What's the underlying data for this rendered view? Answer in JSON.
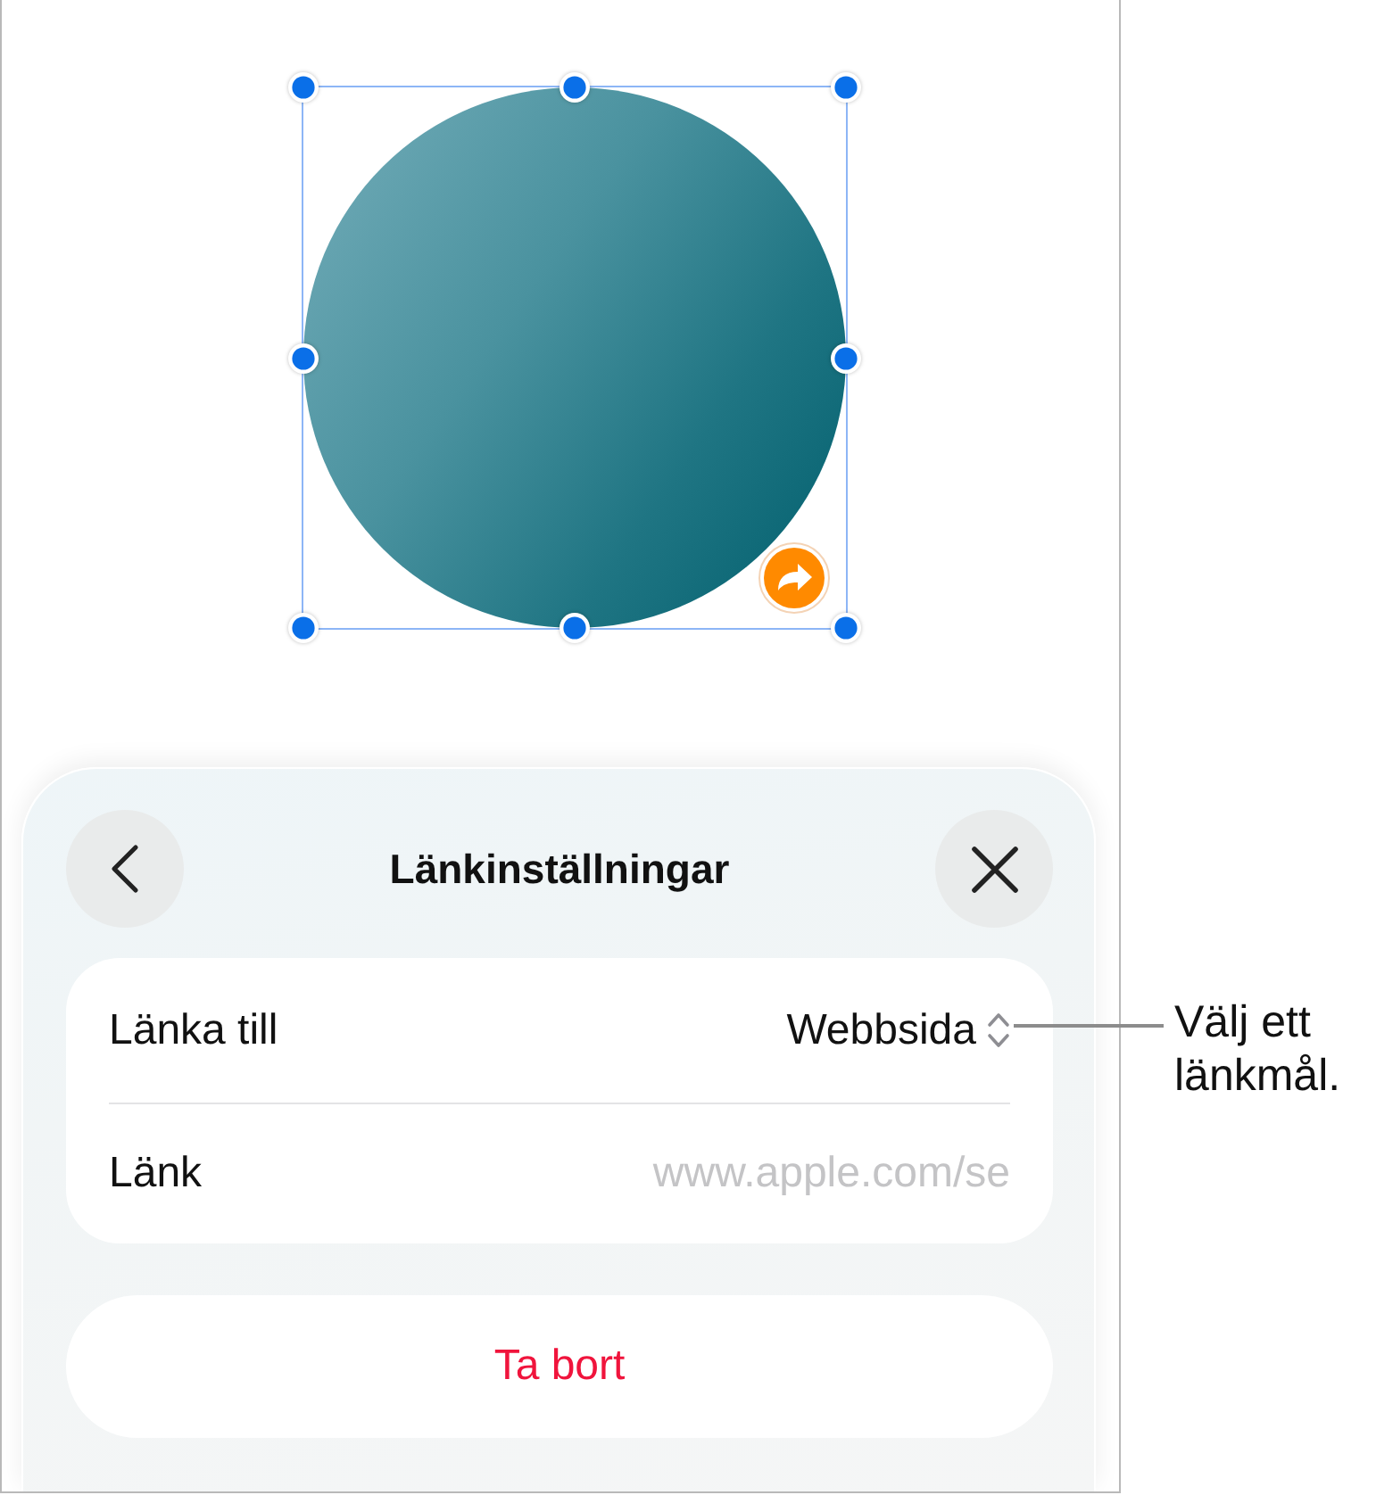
{
  "canvas": {
    "shape": {
      "selected": true,
      "linked": true
    }
  },
  "panel": {
    "title": "Länkinställningar",
    "rows": [
      {
        "kind": "picker",
        "label": "Länka till",
        "value": "Webbsida"
      },
      {
        "kind": "field",
        "label": "Länk",
        "placeholder": "www.apple.com/se"
      }
    ],
    "delete_button": "Ta bort"
  },
  "callouts": [
    {
      "text": "Välj ett länkmål."
    }
  ]
}
